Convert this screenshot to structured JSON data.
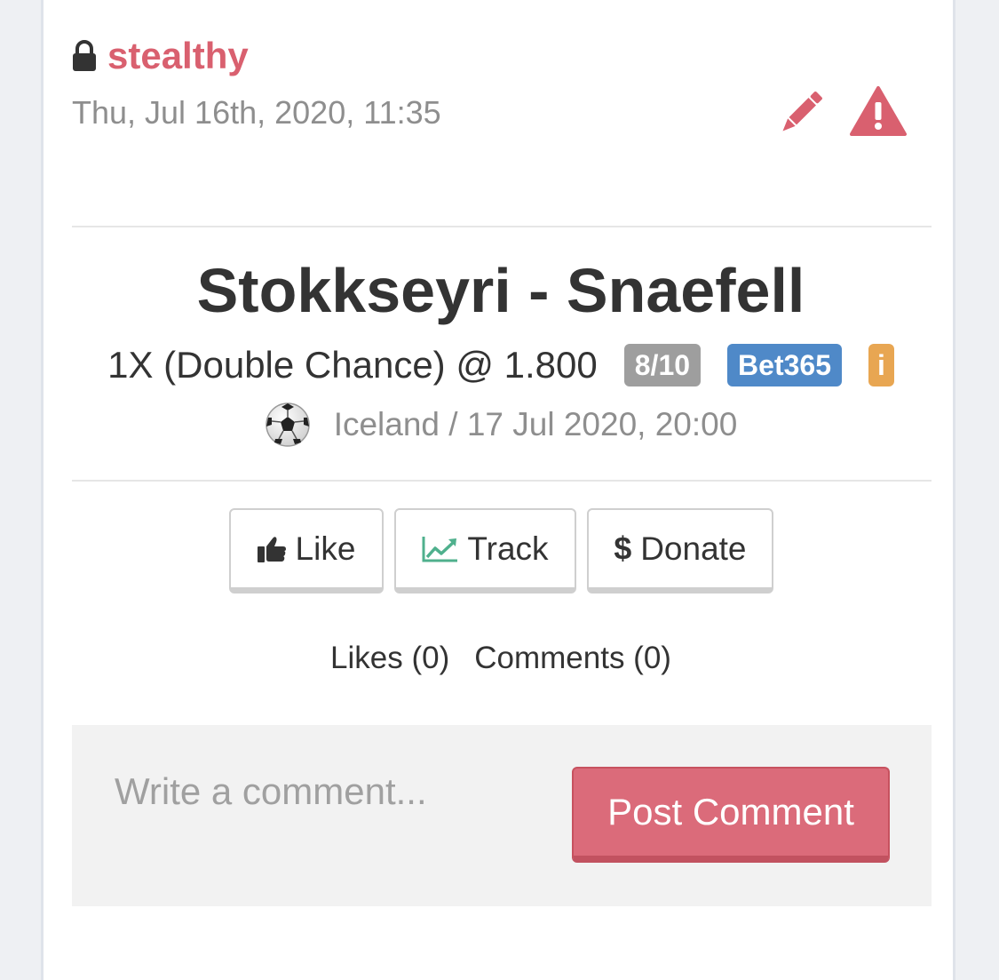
{
  "post": {
    "author": "stealthy",
    "date": "Thu, Jul 16th, 2020, 11:35",
    "lock_icon": "lock-icon",
    "edit_icon": "pencil-icon",
    "report_icon": "warning-icon"
  },
  "pick": {
    "match": "Stokkseyri - Snaefell",
    "selection": "1X (Double Chance) @ 1.800",
    "confidence": "8/10",
    "bookmaker": "Bet365",
    "info": "i",
    "sport_icon": "soccer-ball-icon",
    "meta": "Iceland / 17 Jul 2020, 20:00"
  },
  "actions": {
    "like_label": "Like",
    "track_label": "Track",
    "donate_label": "Donate"
  },
  "counts": {
    "likes": "Likes (0)",
    "comments": "Comments (0)"
  },
  "comment": {
    "placeholder": "Write a comment...",
    "post_label": "Post Comment"
  },
  "colors": {
    "accent": "#d9606f",
    "confidence_badge": "#9e9e9e",
    "bookmaker_badge": "#4f89c8",
    "info_badge": "#e8a652",
    "track_icon": "#4fb08d"
  }
}
